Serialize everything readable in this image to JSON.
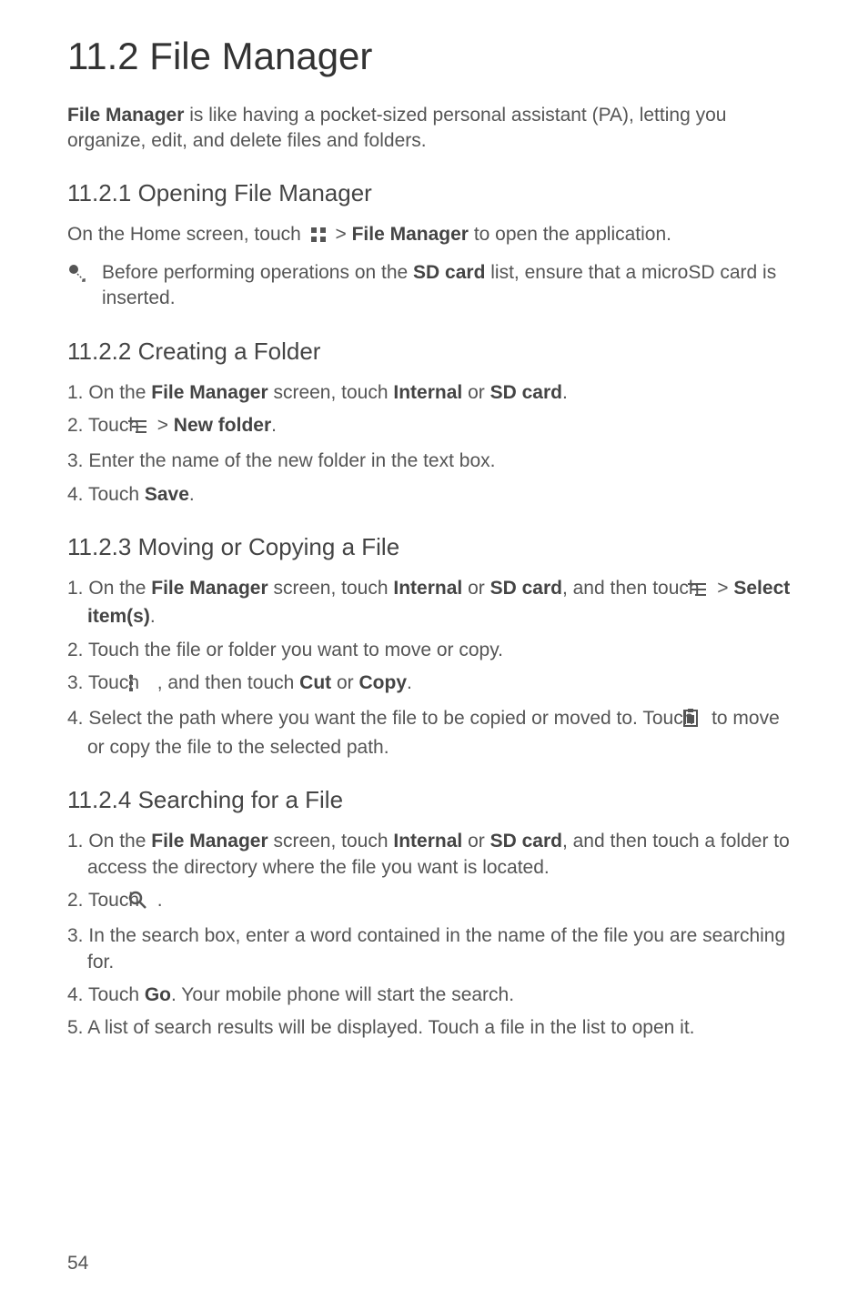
{
  "title": "11.2  File Manager",
  "intro": {
    "pre": "File Manager",
    "rest": " is like having a pocket-sized personal assistant (PA), letting you organize, edit, and delete files and folders."
  },
  "s1": {
    "heading": "11.2.1  Opening File Manager",
    "line": {
      "a": "On the Home screen, touch ",
      "b": "File Manager",
      "c": " to open the application."
    },
    "note": {
      "a": "Before performing operations on the ",
      "b": "SD card",
      "c": " list, ensure that a microSD card is inserted."
    }
  },
  "s2": {
    "heading": "11.2.2  Creating a Folder",
    "li1": {
      "n": "1. ",
      "a": "On the ",
      "b": "File Manager",
      "c": " screen, touch ",
      "d": "Internal",
      "e": " or ",
      "f": "SD card",
      "g": "."
    },
    "li2": {
      "n": "2. ",
      "a": "Touch ",
      "b": "New folder",
      "c": "."
    },
    "li3": {
      "n": "3. ",
      "a": "Enter the name of the new folder in the text box."
    },
    "li4": {
      "n": "4. ",
      "a": "Touch ",
      "b": "Save",
      "c": "."
    }
  },
  "s3": {
    "heading": "11.2.3  Moving or Copying a File",
    "li1": {
      "n": "1. ",
      "a": "On the ",
      "b": "File Manager",
      "c": " screen, touch ",
      "d": "Internal",
      "e": " or ",
      "f": "SD card",
      "g": ", and then touch ",
      "h": "Select item(s)",
      "i": "."
    },
    "li2": {
      "n": "2. ",
      "a": "Touch the file or folder you want to move or copy."
    },
    "li3": {
      "n": "3. ",
      "a": "Touch ",
      "b": " , and then touch ",
      "c": "Cut",
      "d": " or ",
      "e": "Copy",
      "f": "."
    },
    "li4": {
      "n": "4. ",
      "a": "Select the path where you want the file to be copied or moved to. Touch ",
      "b": " to move or copy the file to the selected path."
    }
  },
  "s4": {
    "heading": "11.2.4  Searching for a File",
    "li1": {
      "n": "1. ",
      "a": "On the ",
      "b": "File Manager",
      "c": " screen, touch ",
      "d": "Internal",
      "e": " or ",
      "f": "SD card",
      "g": ", and then touch a folder to access the directory where the file you want is located."
    },
    "li2": {
      "n": "2. ",
      "a": "Touch ",
      "b": " ."
    },
    "li3": {
      "n": "3. ",
      "a": "In the search box, enter a word contained in the name of the file you are searching for."
    },
    "li4": {
      "n": "4. ",
      "a": "Touch ",
      "b": "Go",
      "c": ". Your mobile phone will start the search."
    },
    "li5": {
      "n": "5. ",
      "a": "A list of search results will be displayed. Touch a file in the list to open it."
    }
  },
  "page": "54",
  "gt": " > "
}
